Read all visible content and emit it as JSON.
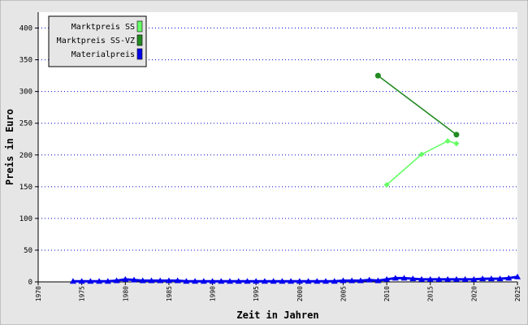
{
  "chart_data": {
    "type": "line",
    "xlabel": "Zeit in Jahren",
    "ylabel": "Preis in Euro",
    "xlim": [
      1970,
      2025
    ],
    "ylim": [
      0,
      425
    ],
    "x_ticks": [
      1970,
      1975,
      1980,
      1985,
      1990,
      1995,
      2000,
      2005,
      2010,
      2015,
      2020,
      2025
    ],
    "y_ticks": [
      0,
      50,
      100,
      150,
      200,
      250,
      300,
      350,
      400
    ],
    "grid": "horizontal dotted",
    "legend_position": "top-left",
    "series": [
      {
        "name": "Marktpreis SS",
        "color": "#66ff66",
        "marker": "diamond",
        "points": [
          [
            2010,
            153
          ],
          [
            2014,
            201
          ],
          [
            2017,
            222
          ],
          [
            2018,
            218
          ]
        ]
      },
      {
        "name": "Marktpreis SS-VZ",
        "color": "#228b22",
        "marker": "circle",
        "points": [
          [
            2009,
            325
          ],
          [
            2018,
            232
          ]
        ]
      },
      {
        "name": "Materialpreis",
        "color": "#0000ee",
        "marker": "triangle",
        "points": [
          [
            1974,
            1
          ],
          [
            1975,
            1
          ],
          [
            1976,
            1
          ],
          [
            1977,
            1
          ],
          [
            1978,
            1
          ],
          [
            1979,
            2
          ],
          [
            1980,
            4
          ],
          [
            1981,
            3
          ],
          [
            1982,
            2
          ],
          [
            1983,
            2
          ],
          [
            1984,
            2
          ],
          [
            1985,
            2
          ],
          [
            1986,
            2
          ],
          [
            1987,
            1
          ],
          [
            1988,
            1
          ],
          [
            1989,
            1
          ],
          [
            1990,
            1
          ],
          [
            1991,
            1
          ],
          [
            1992,
            1
          ],
          [
            1993,
            1
          ],
          [
            1994,
            1
          ],
          [
            1995,
            1
          ],
          [
            1996,
            1
          ],
          [
            1997,
            1
          ],
          [
            1998,
            1
          ],
          [
            1999,
            1
          ],
          [
            2000,
            1
          ],
          [
            2001,
            1
          ],
          [
            2002,
            1
          ],
          [
            2003,
            1
          ],
          [
            2004,
            1
          ],
          [
            2005,
            2
          ],
          [
            2006,
            2
          ],
          [
            2007,
            2
          ],
          [
            2008,
            3
          ],
          [
            2009,
            2
          ],
          [
            2010,
            4
          ],
          [
            2011,
            6
          ],
          [
            2012,
            6
          ],
          [
            2013,
            5
          ],
          [
            2014,
            4
          ],
          [
            2015,
            4
          ],
          [
            2016,
            4
          ],
          [
            2017,
            4
          ],
          [
            2018,
            4
          ],
          [
            2019,
            4
          ],
          [
            2020,
            4
          ],
          [
            2021,
            5
          ],
          [
            2022,
            5
          ],
          [
            2023,
            5
          ],
          [
            2024,
            6
          ],
          [
            2025,
            8
          ]
        ]
      }
    ]
  }
}
